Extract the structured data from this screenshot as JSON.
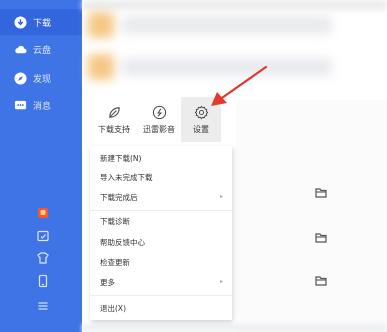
{
  "sidebar": {
    "items": [
      {
        "label": "下载",
        "icon": "download-icon"
      },
      {
        "label": "云盘",
        "icon": "cloud-icon"
      },
      {
        "label": "发现",
        "icon": "compass-icon"
      },
      {
        "label": "消息",
        "icon": "message-icon"
      }
    ],
    "bottom_icons": [
      "gift-icon",
      "screenshot-icon",
      "skin-icon",
      "phone-icon",
      "hamburger-menu-icon"
    ]
  },
  "toolbar": {
    "download_support_label": "下载支持",
    "media_player_label": "迅雷影音",
    "settings_label": "设置"
  },
  "menu": {
    "new_download": "新建下载(N)",
    "import_unfinished": "导入未完成下载",
    "after_download": "下载完成后",
    "diagnose": "下载诊断",
    "feedback": "帮助反馈中心",
    "check_update": "检查更新",
    "more": "更多",
    "exit": "退出(X)",
    "submenu_arrow": "▸"
  },
  "colors": {
    "sidebar_bg": "#3f74e6",
    "accent_red": "#e03a2e",
    "settings_hover": "#ececec"
  }
}
